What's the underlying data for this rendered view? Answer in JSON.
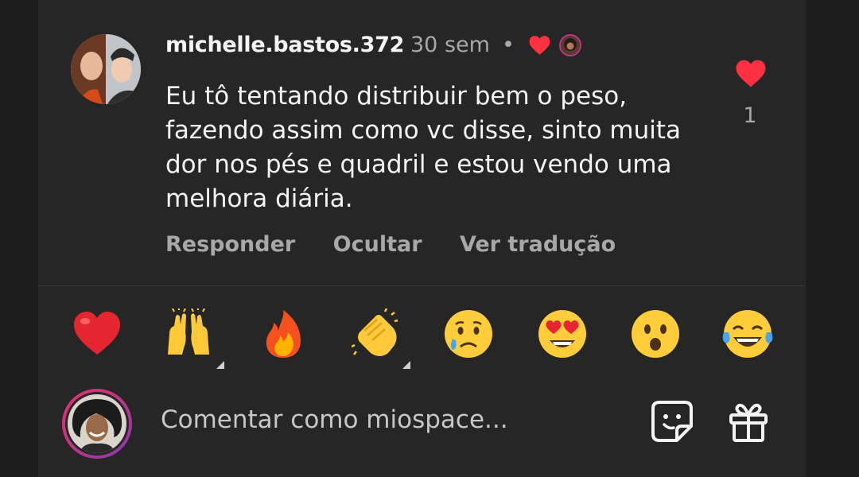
{
  "comment": {
    "username": "michelle.bastos.372",
    "time": "30 sem",
    "separator": "•",
    "text": "Eu tô tentando distribuir bem o peso, fazendo assim como vc disse,  sinto muita dor nos pés e quadril e estou vendo uma melhora diária.",
    "like_count": "1",
    "actions": {
      "reply": "Responder",
      "hide": "Ocultar",
      "translate": "Ver tradução"
    }
  },
  "reactions": [
    "heart-emoji",
    "raising-hands-emoji",
    "fire-emoji",
    "clapping-hands-emoji",
    "crying-face-emoji",
    "heart-eyes-emoji",
    "surprised-face-emoji",
    "tears-of-joy-emoji"
  ],
  "composer": {
    "placeholder": "Comentar como miospace..."
  },
  "colors": {
    "heart": "#ff3040",
    "text": "#f5f5f5",
    "muted": "#a8a8a8",
    "panel": "#262626"
  }
}
